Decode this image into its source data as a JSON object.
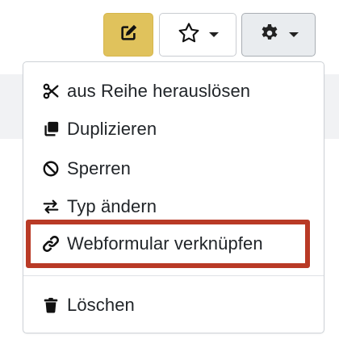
{
  "toolbar": {
    "edit_button": {
      "icon": "pencil-square-icon",
      "color": "#e0c25c"
    },
    "star_button": {
      "icon": "star-outline-icon"
    },
    "settings_button": {
      "icon": "gear-icon"
    }
  },
  "menu": {
    "items": [
      {
        "icon": "scissors-icon",
        "label": "aus Reihe herauslösen"
      },
      {
        "icon": "copy-icon",
        "label": "Duplizieren"
      },
      {
        "icon": "ban-icon",
        "label": "Sperren"
      },
      {
        "icon": "swap-arrows-icon",
        "label": "Typ ändern"
      },
      {
        "icon": "link-icon",
        "label": "Webformular verknüpfen",
        "highlighted": true
      },
      {
        "icon": "trash-icon",
        "label": "Löschen"
      }
    ],
    "highlight_color": "#b93a26"
  }
}
